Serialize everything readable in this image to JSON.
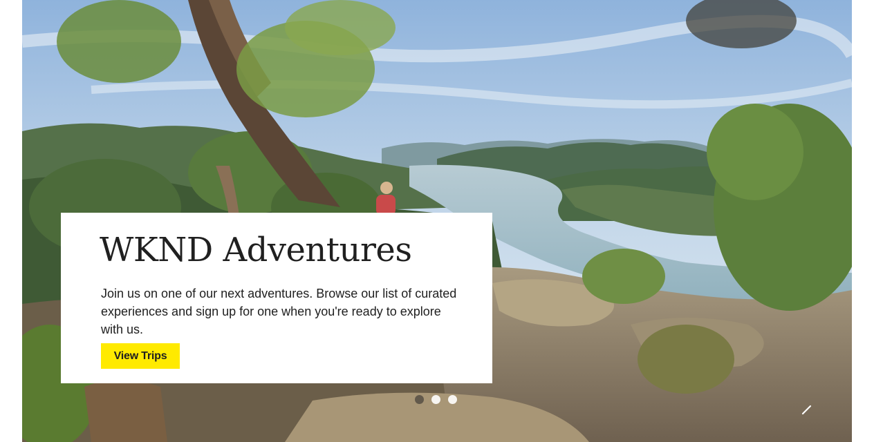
{
  "hero": {
    "image": "hawkesbury-river-lookout-photo",
    "title": "WKND Adventures",
    "description": "Join us on one of our next adventures. Browse our list of curated experiences and sign up for one when you're ready to explore with us.",
    "cta_label": "View Trips"
  },
  "carousel": {
    "slide_count": 3,
    "active_index": 0,
    "next_icon": "chevron-right-icon"
  },
  "colors": {
    "accent": "#ffea00",
    "text": "#202020",
    "card_bg": "#ffffff"
  }
}
